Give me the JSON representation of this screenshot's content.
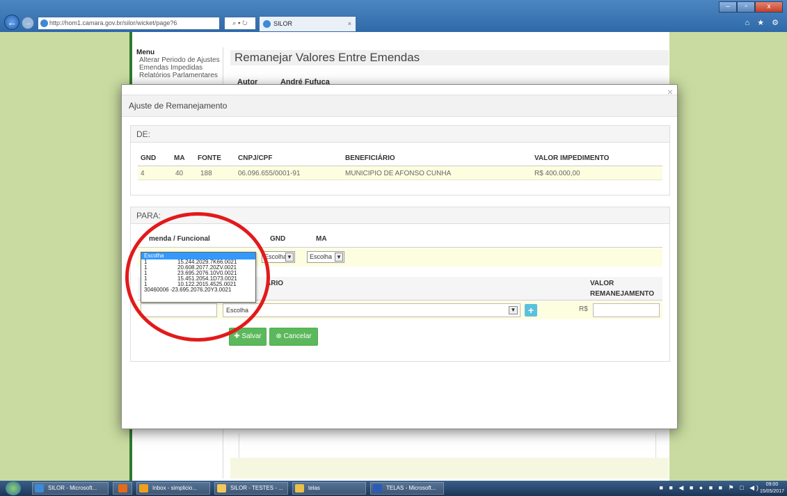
{
  "browser": {
    "url": "http://hom1.camara.gov.br/silor/wicket/page?6",
    "address_controls": "⌕ ▾ ↻",
    "tab_title": "SILOR",
    "tab_close": "×",
    "right_icons": "⌂ ★ ⚙"
  },
  "sidemenu": {
    "title": "Menu",
    "items": [
      "Alterar Periodo de Ajustes",
      "Emendas Impedidas",
      "Relatórios Parlamentares"
    ]
  },
  "page": {
    "title": "Remanejar Valores Entre Emendas",
    "autor_label": "Autor",
    "autor_value": "André Fufuca"
  },
  "modal": {
    "title": "Ajuste de Remanejamento",
    "close": "×",
    "de": {
      "heading": "DE:",
      "columns": [
        "GND",
        "MA",
        "FONTE",
        "CNPJ/CPF",
        "BENEFICIÁRIO",
        "VALOR IMPEDIMENTO"
      ],
      "row": [
        "4",
        "40",
        "188",
        "06.096.655/0001-91",
        "MUNICIPIO DE AFONSO CUNHA",
        "R$ 400.000,00"
      ]
    },
    "para": {
      "heading": "PARA:",
      "columns": [
        "menda / Funcional",
        "GND",
        "MA"
      ],
      "gnd_select": "Escolha",
      "ma_select": "Escolha",
      "beneficiario_header": "ARIO",
      "valor_header_1": "VALOR",
      "valor_header_2": "REMANEJAMENTO",
      "beneficiario_select": "Escolha",
      "plus": "+",
      "rs": "R$",
      "save_label": "Salvar",
      "cancel_label": "Cancelar"
    },
    "dropdown": {
      "selected": "Escolha",
      "options": [
        {
          "prefix": "1",
          "code": "15.244.2029.7K66.0021"
        },
        {
          "prefix": "1",
          "code": "20.608.2077.20ZV.0021"
        },
        {
          "prefix": "1",
          "code": "23.695.2076.10V0.0021"
        },
        {
          "prefix": "1",
          "code": "15.451.2054.1D73.0021"
        },
        {
          "prefix": "1",
          "code": "10.122.2015.4525.0021"
        },
        {
          "prefix": "30460006 -",
          "code": "23.695.2076.20Y3.0021"
        }
      ]
    }
  },
  "taskbar": {
    "items": [
      "SILOR - Microsoft...",
      "",
      "Inbox - simplicio...",
      "SILOR - TESTES - ...",
      "telas",
      "TELAS - Microsoft..."
    ],
    "tray": "■ ■ ◀ ■ ● ■ ■ ⚑ □ ◀)",
    "time": "09:00",
    "date": "15/05/2017"
  },
  "colors": {
    "accent_green": "#5cb85c",
    "info_blue": "#5bc0de",
    "annotation_red": "#e3191b",
    "row_highlight": "#fdfde0"
  }
}
